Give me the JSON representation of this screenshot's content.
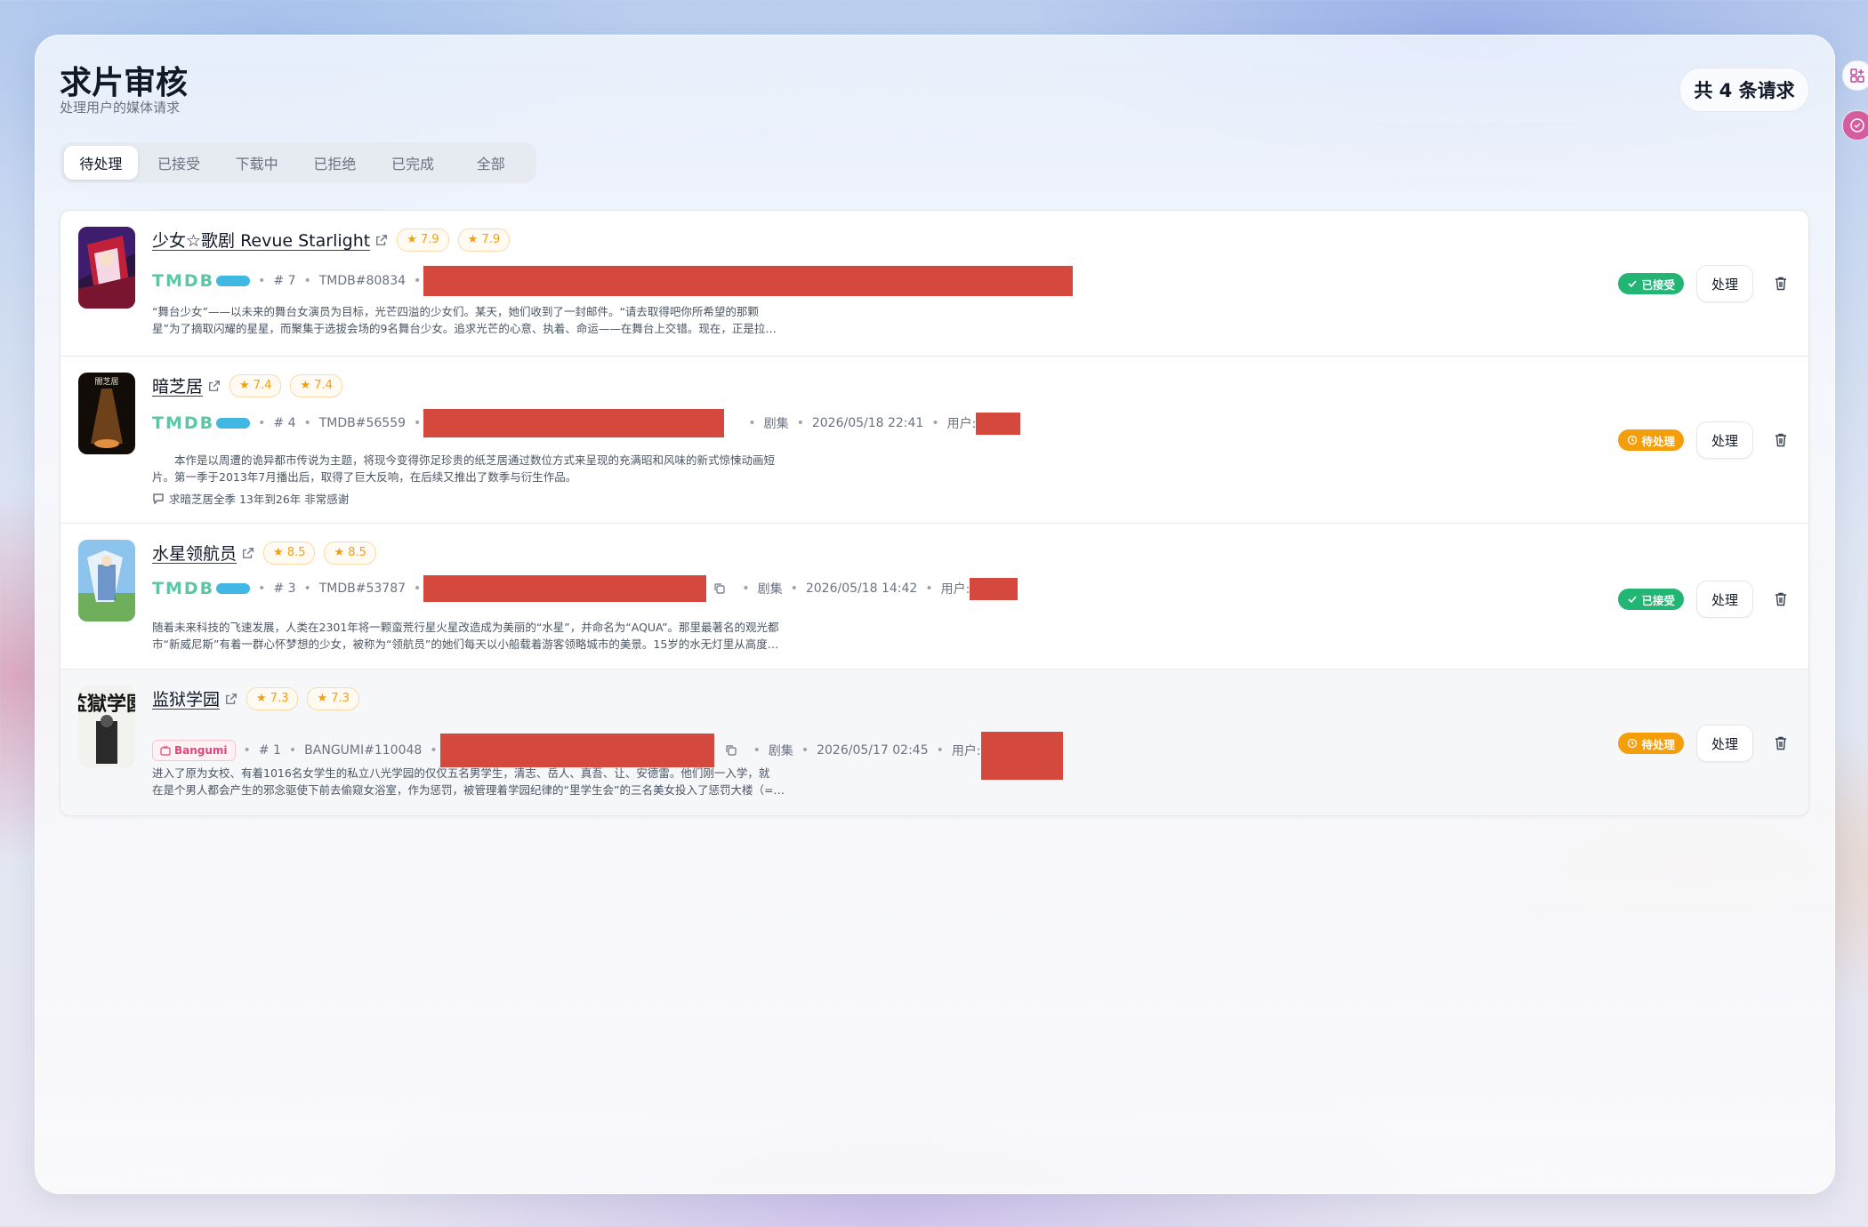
{
  "header": {
    "title": "求片审核",
    "subtitle": "处理用户的媒体请求",
    "count": "共 4 条请求"
  },
  "tabs": [
    "待处理",
    "已接受",
    "下载中",
    "已拒绝",
    "已完成",
    "全部"
  ],
  "active_tab": "待处理",
  "colors": {
    "accepted": "#22b573",
    "pending": "#f59e0b",
    "redaction": "#d5483d"
  },
  "rows": [
    {
      "title": "少女☆歌剧 Revue Starlight",
      "rating1": "★ 7.9",
      "rating2": "★ 7.9",
      "source": "TMDB",
      "index": "# 7",
      "source_id": "TMDB#80834",
      "desc1": "“舞台少女”——以未来的舞台女演员为目标，光芒四溢的少女们。某天，她们收到了一封邮件。“请去取得吧你所希望的那颗",
      "desc2": "星”为了摘取闪耀的星星，而聚集于选拔会场的9名舞台少女。追求光芒的心意、执着、命运——在舞台上交错。现在，正是拉…",
      "status": "已接受",
      "action": "处理"
    },
    {
      "title": "暗芝居",
      "rating1": "★ 7.4",
      "rating2": "★ 7.4",
      "source": "TMDB",
      "index": "# 4",
      "source_id": "TMDB#56559",
      "type": "剧集",
      "date": "2026/05/18 22:41",
      "user_label": "用户:",
      "desc1": "　　本作是以周遭的诡异都市传说为主题，将现今变得弥足珍贵的纸芝居通过数位方式来呈现的充满昭和风味的新式惊悚动画短",
      "desc2": "片。第一季于2013年7月播出后，取得了巨大反响，在后续又推出了数季与衍生作品。",
      "comment": "求暗芝居全季 13年到26年 非常感谢",
      "status": "待处理",
      "action": "处理"
    },
    {
      "title": "水星领航员",
      "rating1": "★ 8.5",
      "rating2": "★ 8.5",
      "source": "TMDB",
      "index": "# 3",
      "source_id": "TMDB#53787",
      "type": "剧集",
      "date": "2026/05/18 14:42",
      "user_label": "用户:",
      "desc1": "随着未来科技的飞速发展，人类在2301年将一颗蛮荒行星火星改造成为美丽的“水星”，并命名为“AQUA”。那里最著名的观光都",
      "desc2": "市“新威尼斯”有着一群心怀梦想的少女，被称为“领航员”的她们每天以小船载着游客领略城市的美景。15岁的水无灯里从高度…",
      "status": "已接受",
      "action": "处理"
    },
    {
      "title": "监狱学园",
      "rating1": "★ 7.3",
      "rating2": "★ 7.3",
      "source": "Bangumi",
      "index": "# 1",
      "source_id": "BANGUMI#110048",
      "type": "剧集",
      "date": "2026/05/17 02:45",
      "user_label": "用户:",
      "desc1": "进入了原为女校、有着1016名女学生的私立八光学园的仅仅五名男学生，清志、岳人、真吾、让、安德雷。他们刚一入学，就",
      "desc2": "在是个男人都会产生的邪念驱使下前去偷窥女浴室，作为惩罚，被管理着学园纪律的“里学生会”的三名美女投入了惩罚大楼（=…",
      "status": "待处理",
      "action": "处理",
      "poster_text": "監獄学園"
    }
  ],
  "poster2_text": "闇芝居"
}
